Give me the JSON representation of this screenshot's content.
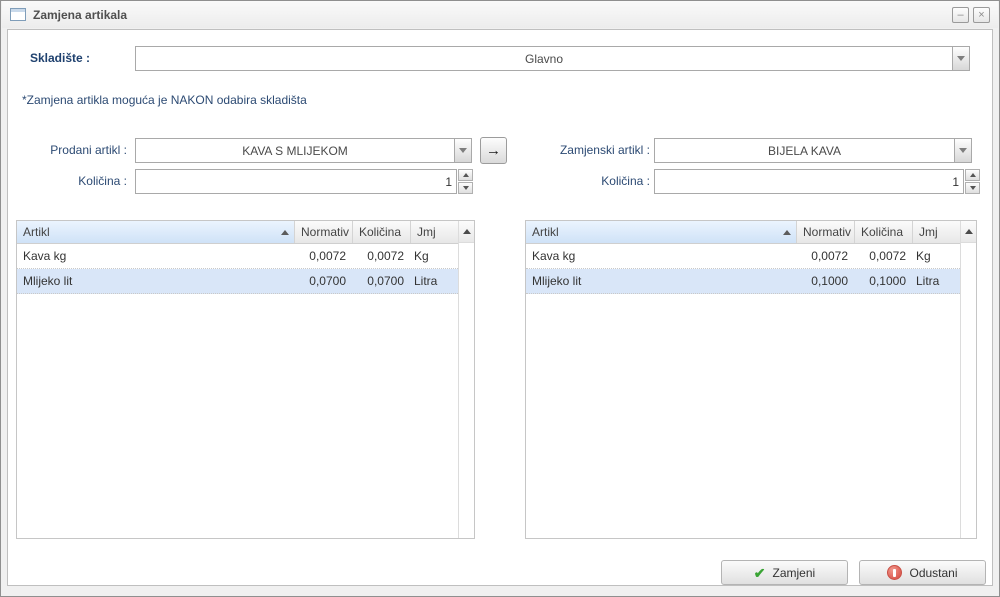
{
  "window": {
    "title": "Zamjena artikala",
    "minimize": "–",
    "close": "×"
  },
  "form": {
    "warehouse_label": "Skladište :",
    "warehouse_value": "Glavno",
    "note": "*Zamjena artikla moguća je NAKON odabira skladišta",
    "sold_label": "Prodani artikl :",
    "sold_value": "KAVA S MLIJEKOM",
    "sold_qty_label": "Količina :",
    "sold_qty_value": "1",
    "replacement_label": "Zamjenski artikl :",
    "replacement_value": "BIJELA KAVA",
    "replacement_qty_label": "Količina :",
    "replacement_qty_value": "1",
    "transfer_arrow": "→"
  },
  "tables": {
    "columns": [
      "Artikl",
      "Normativ",
      "Količina",
      "Jmj"
    ],
    "left_rows": [
      {
        "artikl": "Kava kg",
        "normativ": "0,0072",
        "kolicina": "0,0072",
        "jmj": "Kg",
        "selected": false
      },
      {
        "artikl": "Mlijeko lit",
        "normativ": "0,0700",
        "kolicina": "0,0700",
        "jmj": "Litra",
        "selected": true
      }
    ],
    "right_rows": [
      {
        "artikl": "Kava kg",
        "normativ": "0,0072",
        "kolicina": "0,0072",
        "jmj": "Kg",
        "selected": false
      },
      {
        "artikl": "Mlijeko lit",
        "normativ": "0,1000",
        "kolicina": "0,1000",
        "jmj": "Litra",
        "selected": true
      }
    ]
  },
  "footer": {
    "confirm": "Zamjeni",
    "cancel": "Odustani"
  },
  "colors": {
    "label_navy": "#2c4a73",
    "selected_row": "#d9e6f8",
    "sorted_header": "#cfe2f7",
    "accent_green": "#3aa435",
    "accent_red": "#dd5f55"
  }
}
